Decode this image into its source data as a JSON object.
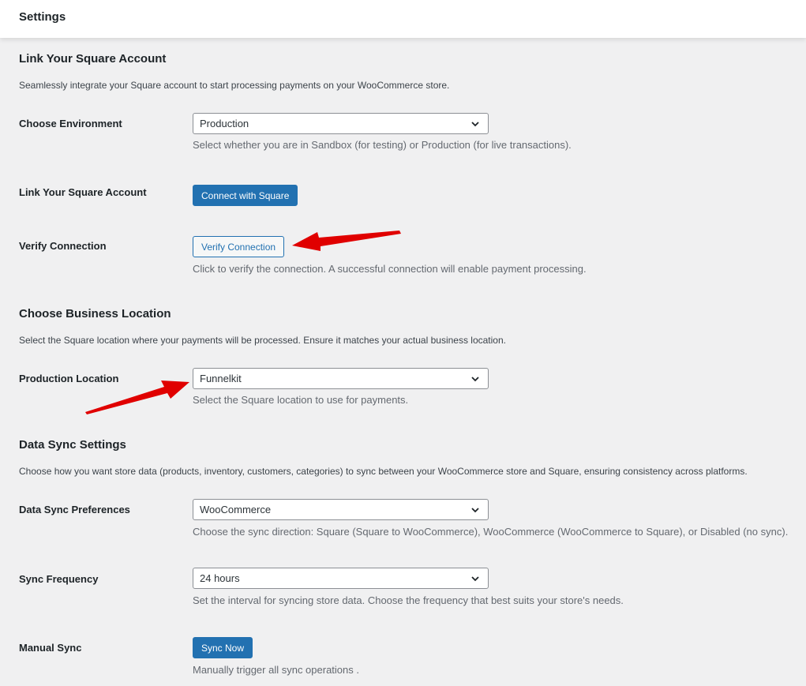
{
  "header": {
    "title": "Settings"
  },
  "link_section": {
    "title": "Link Your Square Account",
    "description": "Seamlessly integrate your Square account to start processing payments on your WooCommerce store.",
    "environment": {
      "label": "Choose Environment",
      "selected": "Production",
      "help": "Select whether you are in Sandbox (for testing) or Production (for live transactions)."
    },
    "link_account": {
      "label": "Link Your Square Account",
      "button": "Connect with Square"
    },
    "verify": {
      "label": "Verify Connection",
      "button": "Verify Connection",
      "help": "Click to verify the connection. A successful connection will enable payment processing."
    }
  },
  "location_section": {
    "title": "Choose Business Location",
    "description": "Select the Square location where your payments will be processed. Ensure it matches your actual business location.",
    "production_location": {
      "label": "Production Location",
      "selected": "Funnelkit",
      "help": "Select the Square location to use for payments."
    }
  },
  "sync_section": {
    "title": "Data Sync Settings",
    "description": "Choose how you want store data (products, inventory, customers, categories) to sync between your WooCommerce store and Square, ensuring consistency across platforms.",
    "preferences": {
      "label": "Data Sync Preferences",
      "selected": "WooCommerce",
      "help": "Choose the sync direction: Square (Square to WooCommerce), WooCommerce (WooCommerce to Square), or Disabled (no sync)."
    },
    "frequency": {
      "label": "Sync Frequency",
      "selected": "24 hours",
      "help": "Set the interval for syncing store data. Choose the frequency that best suits your store's needs."
    },
    "manual": {
      "label": "Manual Sync",
      "button": "Sync Now",
      "help": "Manually trigger all sync operations ."
    }
  },
  "colors": {
    "primary": "#2271b1",
    "background": "#f0f0f1",
    "annotation_arrow": "#e00000"
  },
  "icons": [
    "chevron-down-icon",
    "annotation-arrow"
  ]
}
